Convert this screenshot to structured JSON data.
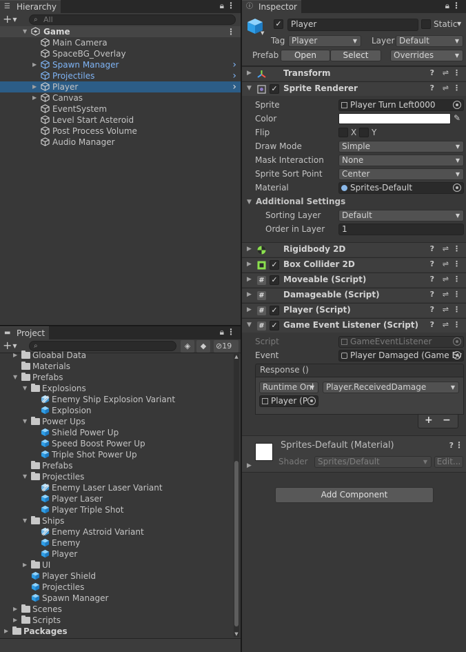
{
  "hierarchy": {
    "tab": "Hierarchy",
    "search_placeholder": "All",
    "scene": "Game",
    "items": [
      {
        "label": "Main Camera",
        "blue": false,
        "expand": false,
        "selected": false
      },
      {
        "label": "SpaceBG_Overlay",
        "blue": false,
        "expand": false,
        "selected": false
      },
      {
        "label": "Spawn Manager",
        "blue": true,
        "expand": true,
        "selected": false
      },
      {
        "label": "Projectiles",
        "blue": true,
        "expand": false,
        "selected": false
      },
      {
        "label": "Player",
        "blue": false,
        "expand": true,
        "selected": true
      },
      {
        "label": "Canvas",
        "blue": false,
        "expand": true,
        "selected": false
      },
      {
        "label": "EventSystem",
        "blue": false,
        "expand": false,
        "selected": false
      },
      {
        "label": "Level Start Asteroid",
        "blue": false,
        "expand": false,
        "selected": false
      },
      {
        "label": "Post Process Volume",
        "blue": false,
        "expand": false,
        "selected": false
      },
      {
        "label": "Audio Manager",
        "blue": false,
        "expand": false,
        "selected": false
      }
    ]
  },
  "project": {
    "tab": "Project",
    "hidden_count": "19",
    "tree": [
      {
        "label": "Gloabal Data",
        "type": "folder",
        "level": 1,
        "arrow": "closed"
      },
      {
        "label": "Materials",
        "type": "folder",
        "level": 1,
        "arrow": "none"
      },
      {
        "label": "Prefabs",
        "type": "folder",
        "level": 1,
        "arrow": "open"
      },
      {
        "label": "Explosions",
        "type": "folder",
        "level": 2,
        "arrow": "open"
      },
      {
        "label": "Enemy Ship Explosion Variant",
        "type": "variant",
        "level": 3,
        "arrow": "none"
      },
      {
        "label": "Explosion",
        "type": "prefab",
        "level": 3,
        "arrow": "none"
      },
      {
        "label": "Power Ups",
        "type": "folder",
        "level": 2,
        "arrow": "open"
      },
      {
        "label": "Shield Power Up",
        "type": "prefab",
        "level": 3,
        "arrow": "none"
      },
      {
        "label": "Speed Boost Power Up",
        "type": "prefab",
        "level": 3,
        "arrow": "none"
      },
      {
        "label": "Triple Shot Power Up",
        "type": "prefab",
        "level": 3,
        "arrow": "none"
      },
      {
        "label": "Prefabs",
        "type": "folder",
        "level": 2,
        "arrow": "none"
      },
      {
        "label": "Projectiles",
        "type": "folder",
        "level": 2,
        "arrow": "open"
      },
      {
        "label": "Enemy Laser Laser Variant",
        "type": "variant",
        "level": 3,
        "arrow": "none"
      },
      {
        "label": "Player Laser",
        "type": "prefab",
        "level": 3,
        "arrow": "none"
      },
      {
        "label": "Player Triple Shot",
        "type": "prefab",
        "level": 3,
        "arrow": "none"
      },
      {
        "label": "Ships",
        "type": "folder",
        "level": 2,
        "arrow": "open"
      },
      {
        "label": "Enemy Astroid Variant",
        "type": "variant",
        "level": 3,
        "arrow": "none"
      },
      {
        "label": "Enemy",
        "type": "prefab",
        "level": 3,
        "arrow": "none"
      },
      {
        "label": "Player",
        "type": "prefab",
        "level": 3,
        "arrow": "none"
      },
      {
        "label": "UI",
        "type": "folder",
        "level": 2,
        "arrow": "closed"
      },
      {
        "label": "Player Shield",
        "type": "prefab",
        "level": 2,
        "arrow": "none"
      },
      {
        "label": "Projectiles",
        "type": "prefab",
        "level": 2,
        "arrow": "none"
      },
      {
        "label": "Spawn Manager",
        "type": "prefab",
        "level": 2,
        "arrow": "none"
      },
      {
        "label": "Scenes",
        "type": "folder",
        "level": 1,
        "arrow": "closed"
      },
      {
        "label": "Scripts",
        "type": "folder",
        "level": 1,
        "arrow": "closed"
      },
      {
        "label": "Packages",
        "type": "folder-bold",
        "level": 0,
        "arrow": "closed"
      }
    ]
  },
  "inspector": {
    "tab": "Inspector",
    "object_name": "Player",
    "static_label": "Static",
    "tag_label": "Tag",
    "tag_value": "Player",
    "layer_label": "Layer",
    "layer_value": "Default",
    "prefab_label": "Prefab",
    "open_btn": "Open",
    "select_btn": "Select",
    "overrides": "Overrides",
    "components": {
      "transform": "Transform",
      "sprite_renderer": "Sprite Renderer",
      "rigidbody": "Rigidbody 2D",
      "box_collider": "Box Collider 2D",
      "moveable": "Moveable (Script)",
      "damageable": "Damageable (Script)",
      "player_script": "Player (Script)",
      "gel": "Game Event Listener (Script)"
    },
    "sprite_renderer": {
      "sprite_label": "Sprite",
      "sprite_value": "Player Turn Left0000",
      "color_label": "Color",
      "color_value": "#ffffff",
      "flip_label": "Flip",
      "flip_x": "X",
      "flip_y": "Y",
      "draw_mode_label": "Draw Mode",
      "draw_mode_value": "Simple",
      "mask_label": "Mask Interaction",
      "mask_value": "None",
      "sort_point_label": "Sprite Sort Point",
      "sort_point_value": "Center",
      "material_label": "Material",
      "material_value": "Sprites-Default",
      "additional": "Additional Settings",
      "sorting_layer_label": "Sorting Layer",
      "sorting_layer_value": "Default",
      "order_label": "Order in Layer",
      "order_value": "1"
    },
    "gel": {
      "script_label": "Script",
      "script_value": "GameEventListener",
      "event_label": "Event",
      "event_value": "Player Damaged (Game Ev",
      "response_label": "Response ()",
      "runtime_value": "Runtime Onl",
      "method_value": "Player.ReceivedDamage",
      "object_value": "Player (P",
      "plus": "+",
      "minus": "−"
    },
    "material": {
      "name": "Sprites-Default (Material)",
      "shader_label": "Shader",
      "shader_value": "Sprites/Default",
      "edit_btn": "Edit..."
    },
    "add_component": "Add Component"
  }
}
